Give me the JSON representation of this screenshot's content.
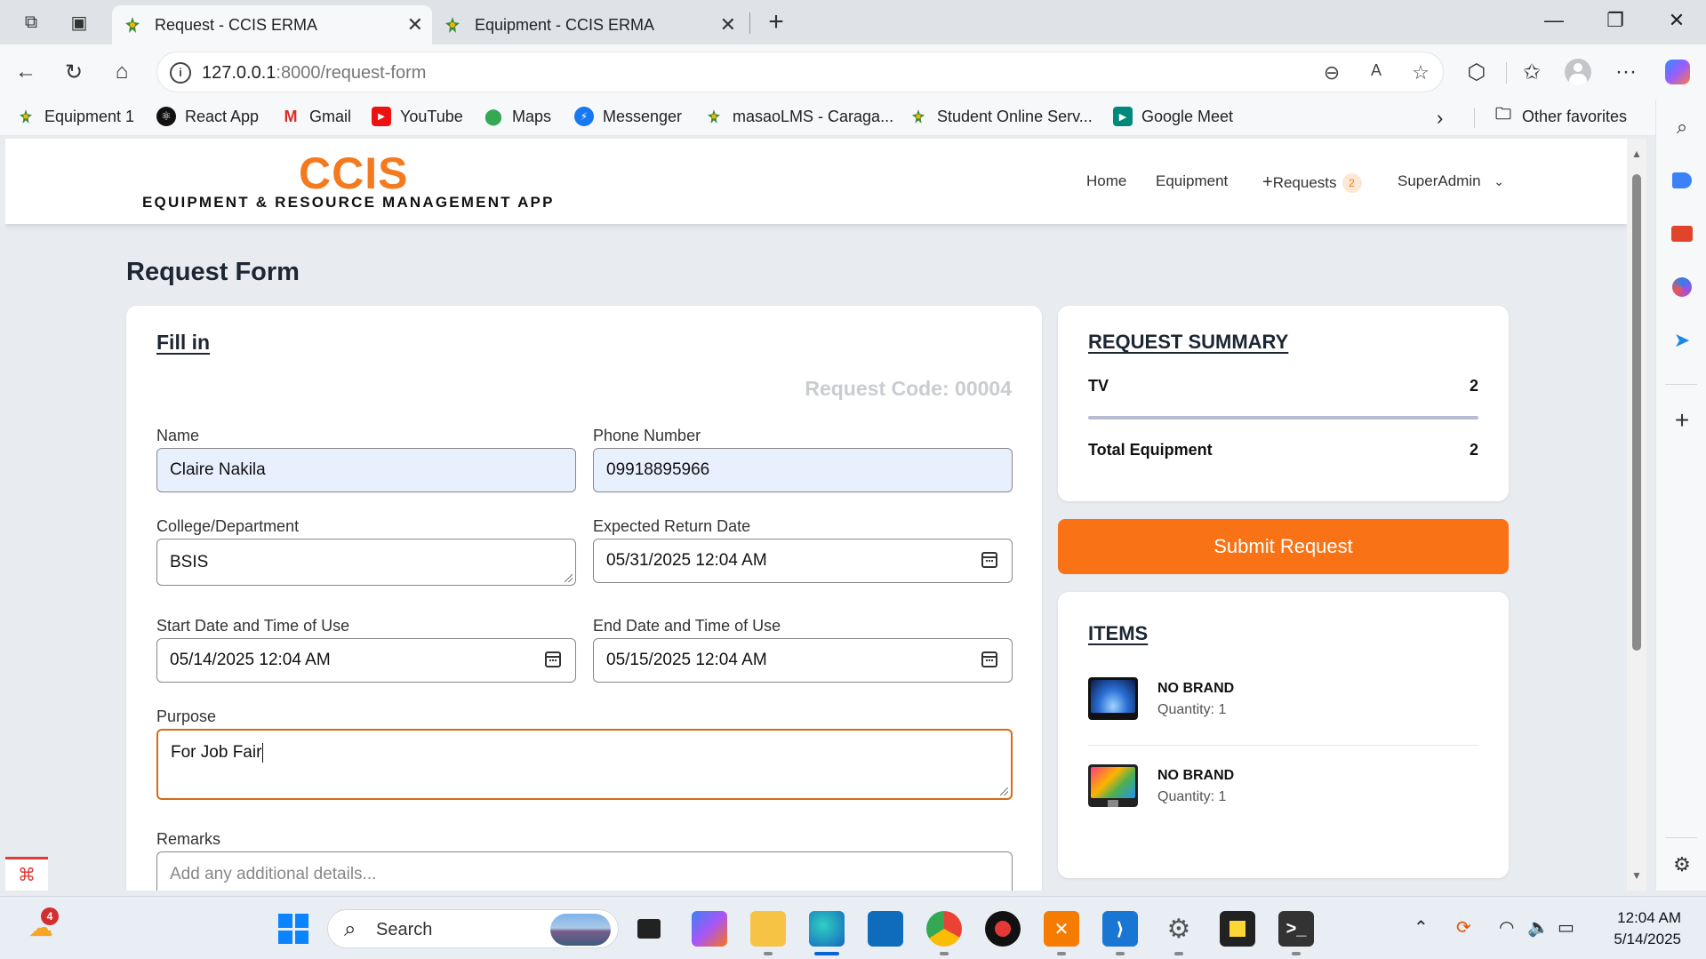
{
  "browser": {
    "tabs": [
      {
        "title": "Request - CCIS ERMA",
        "active": true
      },
      {
        "title": "Equipment - CCIS ERMA",
        "active": false
      }
    ],
    "address": {
      "host": "127.0.0.1",
      "path": ":8000/request-form"
    },
    "bookmarks": [
      "Equipment 1",
      "React App",
      "Gmail",
      "YouTube",
      "Maps",
      "Messenger",
      "masaoLMS - Caraga...",
      "Student Online Serv...",
      "Google Meet"
    ],
    "other_favorites": "Other favorites"
  },
  "app": {
    "logo": "CCIS",
    "logo_sub": "EQUIPMENT & RESOURCE MANAGEMENT APP",
    "nav": {
      "home": "Home",
      "equipment": "Equipment",
      "requests": "Requests",
      "requests_count": "2",
      "user": "SuperAdmin"
    }
  },
  "page": {
    "title": "Request Form",
    "fill_in": "Fill in",
    "request_code": "Request Code: 00004",
    "fields": {
      "name": {
        "label": "Name",
        "value": "Claire Nakila"
      },
      "phone": {
        "label": "Phone Number",
        "value": "09918895966"
      },
      "college": {
        "label": "College/Department",
        "value": "BSIS"
      },
      "return_date": {
        "label": "Expected Return Date",
        "value": "05/31/2025 12:04 AM"
      },
      "start_date": {
        "label": "Start Date and Time of Use",
        "value": "05/14/2025 12:04 AM"
      },
      "end_date": {
        "label": "End Date and Time of Use",
        "value": "05/15/2025 12:04 AM"
      },
      "purpose": {
        "label": "Purpose",
        "value": "For Job Fair"
      },
      "remarks": {
        "label": "Remarks",
        "placeholder": "Add any additional details..."
      }
    },
    "summary": {
      "title": "REQUEST SUMMARY",
      "rows": [
        {
          "name": "TV",
          "qty": "2"
        }
      ],
      "total_label": "Total Equipment",
      "total_value": "2"
    },
    "submit_label": "Submit Request",
    "items": {
      "title": "ITEMS",
      "list": [
        {
          "name": "NO BRAND",
          "qty": "Quantity: 1"
        },
        {
          "name": "NO BRAND",
          "qty": "Quantity: 1"
        }
      ]
    }
  },
  "taskbar": {
    "search": "Search",
    "time": "12:04 AM",
    "date": "5/14/2025",
    "weather_badge": "4"
  },
  "colors": {
    "accent": "#f97316",
    "logo": "#f47a20"
  }
}
